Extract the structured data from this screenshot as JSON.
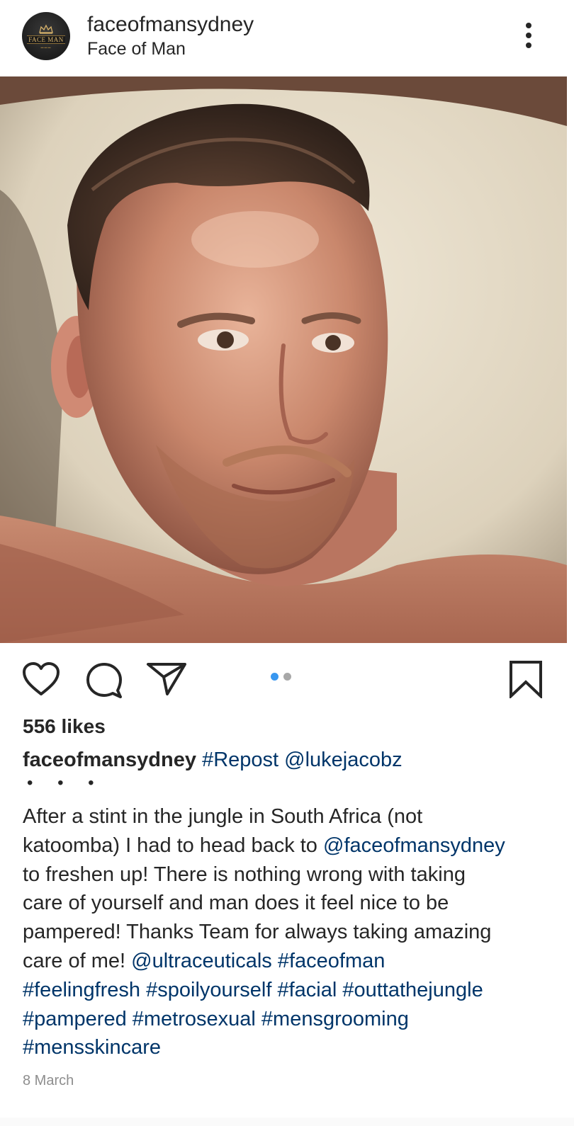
{
  "post": {
    "username": "faceofmansydney",
    "location": "Face of Man",
    "avatar_logo_text": "FACE MAN",
    "likes_text": "556 likes",
    "caption_user": "faceofmansydney",
    "caption_first_tags": [
      "#Repost",
      "@lukejacobz"
    ],
    "caption_ellipsis": "• • •",
    "caption_lines": [
      [
        {
          "t": "After a stint in the jungle in South Africa (not",
          "tag": false
        }
      ],
      [
        {
          "t": "katoomba) I had to head back to ",
          "tag": false
        },
        {
          "t": "@faceofmansydney",
          "tag": true
        }
      ],
      [
        {
          "t": "to freshen up! There is nothing wrong with taking",
          "tag": false
        }
      ],
      [
        {
          "t": "care of yourself and man does it feel nice to be",
          "tag": false
        }
      ],
      [
        {
          "t": "pampered! Thanks Team for always taking amazing",
          "tag": false
        }
      ],
      [
        {
          "t": "care of me! ",
          "tag": false
        },
        {
          "t": "@ultraceuticals #faceofman",
          "tag": true
        }
      ],
      [
        {
          "t": "#feelingfresh #spoilyourself #facial #outtathejungle",
          "tag": true
        }
      ],
      [
        {
          "t": "#pampered #metrosexual #mensgrooming",
          "tag": true
        }
      ],
      [
        {
          "t": "#mensskincare",
          "tag": true
        }
      ]
    ],
    "date": "8 March",
    "carousel": {
      "count": 2,
      "active": 0
    }
  },
  "icons": {
    "more": "more-vertical-icon",
    "like": "heart-icon",
    "comment": "comment-bubble-icon",
    "share": "paper-plane-icon",
    "save": "bookmark-icon"
  },
  "colors": {
    "link": "#003569",
    "active_dot": "#3897f0",
    "inactive_dot": "#a8a8a8",
    "text": "#262626",
    "date": "#8e8e8e"
  }
}
